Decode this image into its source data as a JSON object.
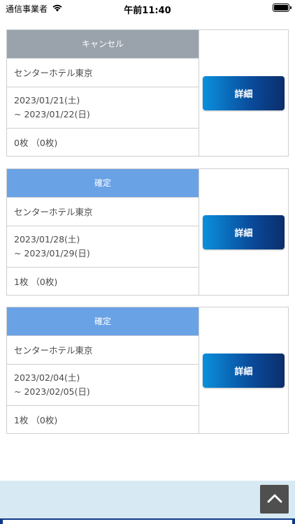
{
  "status_bar": {
    "carrier": "通信事業者",
    "time": "午前11:40"
  },
  "bookings": [
    {
      "status": "キャンセル",
      "status_type": "cancel",
      "hotel": "センターホテル東京",
      "date_from": "2023/01/21(土)",
      "date_to": "~ 2023/01/22(日)",
      "tickets": "0枚 （0枚)",
      "detail_label": "詳細"
    },
    {
      "status": "確定",
      "status_type": "confirm",
      "hotel": "センターホテル東京",
      "date_from": "2023/01/28(土)",
      "date_to": "~ 2023/01/29(日)",
      "tickets": "1枚 （0枚)",
      "detail_label": "詳細"
    },
    {
      "status": "確定",
      "status_type": "confirm",
      "hotel": "センターホテル東京",
      "date_from": "2023/02/04(土)",
      "date_to": "~ 2023/02/05(日)",
      "tickets": "1枚 （0枚)",
      "detail_label": "詳細"
    }
  ],
  "colors": {
    "cancel_header": "#9aa3ab",
    "confirm_header": "#6aa2e6",
    "detail_button_start": "#0a8fdc",
    "detail_button_end": "#0b2e6a",
    "footer_band": "#d7eaf3"
  },
  "icons": {
    "wifi": "wifi-icon",
    "battery": "battery-icon",
    "scroll_top": "chevron-up-icon"
  }
}
